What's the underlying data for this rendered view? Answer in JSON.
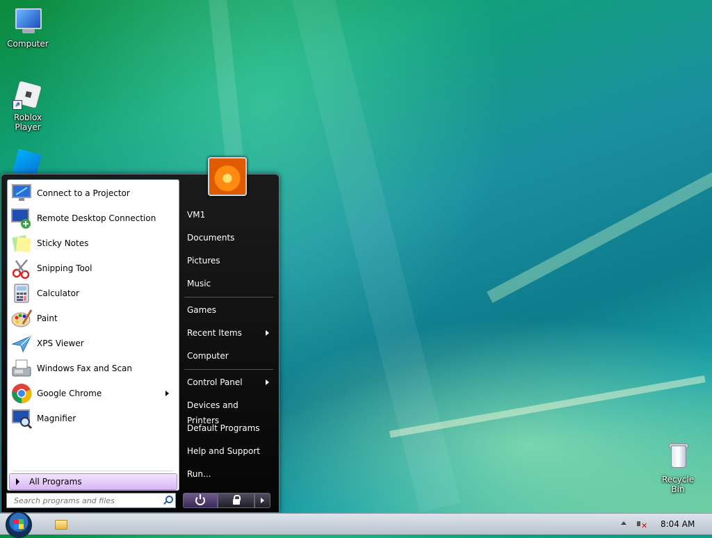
{
  "desktop": {
    "icons": [
      {
        "label": "Computer"
      },
      {
        "label": "Roblox Player"
      }
    ],
    "recycle_bin": "Recycle Bin"
  },
  "start_menu": {
    "programs": [
      {
        "label": "Connect to a Projector",
        "icon": "projector-icon"
      },
      {
        "label": "Remote Desktop Connection",
        "icon": "remote-desktop-icon"
      },
      {
        "label": "Sticky Notes",
        "icon": "sticky-notes-icon"
      },
      {
        "label": "Snipping Tool",
        "icon": "scissors-icon"
      },
      {
        "label": "Calculator",
        "icon": "calculator-icon"
      },
      {
        "label": "Paint",
        "icon": "palette-icon"
      },
      {
        "label": "XPS Viewer",
        "icon": "paper-plane-icon"
      },
      {
        "label": "Windows Fax and Scan",
        "icon": "fax-icon"
      },
      {
        "label": "Google Chrome",
        "icon": "chrome-icon"
      },
      {
        "label": "Magnifier",
        "icon": "magnifier-icon"
      }
    ],
    "all_programs": "All Programs",
    "search_placeholder": "Search programs and files",
    "right_items": [
      {
        "label": "VM1"
      },
      {
        "label": "Documents"
      },
      {
        "label": "Pictures"
      },
      {
        "label": "Music"
      },
      {
        "label": "Games"
      },
      {
        "label": "Recent Items"
      },
      {
        "label": "Computer"
      },
      {
        "label": "Control Panel"
      },
      {
        "label": "Devices and Printers"
      },
      {
        "label": "Default Programs"
      },
      {
        "label": "Help and Support"
      },
      {
        "label": "Run..."
      }
    ]
  },
  "taskbar": {
    "clock": "8:04 AM"
  }
}
